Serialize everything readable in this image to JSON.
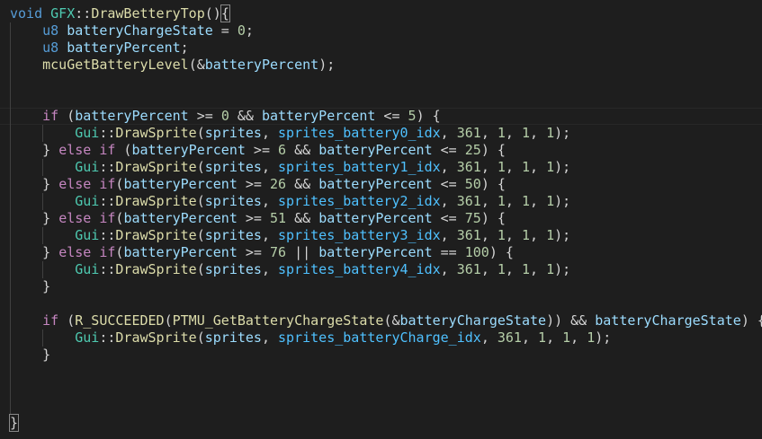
{
  "editor": {
    "current_line": 6,
    "lines": [
      [
        [
          "kw",
          "void "
        ],
        [
          "type",
          "GFX"
        ],
        [
          "p",
          "::"
        ],
        [
          "fn",
          "DrawBetteryTop"
        ],
        [
          "p",
          "()"
        ],
        [
          "match",
          "{"
        ]
      ],
      [
        [
          "p",
          "    "
        ],
        [
          "kw",
          "u8 "
        ],
        [
          "var",
          "batteryChargeState"
        ],
        [
          "p",
          " = "
        ],
        [
          "num",
          "0"
        ],
        [
          "p",
          ";"
        ]
      ],
      [
        [
          "p",
          "    "
        ],
        [
          "kw",
          "u8 "
        ],
        [
          "var",
          "batteryPercent"
        ],
        [
          "p",
          ";"
        ]
      ],
      [
        [
          "p",
          "    "
        ],
        [
          "fn",
          "mcuGetBatteryLevel"
        ],
        [
          "p",
          "(&"
        ],
        [
          "var",
          "batteryPercent"
        ],
        [
          "p",
          ");"
        ]
      ],
      [],
      [],
      [
        [
          "p",
          "    "
        ],
        [
          "ctl",
          "if"
        ],
        [
          "p",
          " ("
        ],
        [
          "var",
          "batteryPercent"
        ],
        [
          "p",
          " >= "
        ],
        [
          "num",
          "0"
        ],
        [
          "p",
          " && "
        ],
        [
          "var",
          "batteryPercent"
        ],
        [
          "p",
          " <= "
        ],
        [
          "num",
          "5"
        ],
        [
          "p",
          ") {"
        ]
      ],
      [
        [
          "p",
          "        "
        ],
        [
          "type",
          "Gui"
        ],
        [
          "p",
          "::"
        ],
        [
          "fn",
          "DrawSprite"
        ],
        [
          "p",
          "("
        ],
        [
          "var",
          "sprites"
        ],
        [
          "p",
          ", "
        ],
        [
          "enum",
          "sprites_battery0_idx"
        ],
        [
          "p",
          ", "
        ],
        [
          "num",
          "361"
        ],
        [
          "p",
          ", "
        ],
        [
          "num",
          "1"
        ],
        [
          "p",
          ", "
        ],
        [
          "num",
          "1"
        ],
        [
          "p",
          ", "
        ],
        [
          "num",
          "1"
        ],
        [
          "p",
          ");"
        ]
      ],
      [
        [
          "p",
          "    } "
        ],
        [
          "ctl",
          "else if"
        ],
        [
          "p",
          " ("
        ],
        [
          "var",
          "batteryPercent"
        ],
        [
          "p",
          " >= "
        ],
        [
          "num",
          "6"
        ],
        [
          "p",
          " && "
        ],
        [
          "var",
          "batteryPercent"
        ],
        [
          "p",
          " <= "
        ],
        [
          "num",
          "25"
        ],
        [
          "p",
          ") {"
        ]
      ],
      [
        [
          "p",
          "        "
        ],
        [
          "type",
          "Gui"
        ],
        [
          "p",
          "::"
        ],
        [
          "fn",
          "DrawSprite"
        ],
        [
          "p",
          "("
        ],
        [
          "var",
          "sprites"
        ],
        [
          "p",
          ", "
        ],
        [
          "enum",
          "sprites_battery1_idx"
        ],
        [
          "p",
          ", "
        ],
        [
          "num",
          "361"
        ],
        [
          "p",
          ", "
        ],
        [
          "num",
          "1"
        ],
        [
          "p",
          ", "
        ],
        [
          "num",
          "1"
        ],
        [
          "p",
          ", "
        ],
        [
          "num",
          "1"
        ],
        [
          "p",
          ");"
        ]
      ],
      [
        [
          "p",
          "    } "
        ],
        [
          "ctl",
          "else if"
        ],
        [
          "p",
          "("
        ],
        [
          "var",
          "batteryPercent"
        ],
        [
          "p",
          " >= "
        ],
        [
          "num",
          "26"
        ],
        [
          "p",
          " && "
        ],
        [
          "var",
          "batteryPercent"
        ],
        [
          "p",
          " <= "
        ],
        [
          "num",
          "50"
        ],
        [
          "p",
          ") {"
        ]
      ],
      [
        [
          "p",
          "        "
        ],
        [
          "type",
          "Gui"
        ],
        [
          "p",
          "::"
        ],
        [
          "fn",
          "DrawSprite"
        ],
        [
          "p",
          "("
        ],
        [
          "var",
          "sprites"
        ],
        [
          "p",
          ", "
        ],
        [
          "enum",
          "sprites_battery2_idx"
        ],
        [
          "p",
          ", "
        ],
        [
          "num",
          "361"
        ],
        [
          "p",
          ", "
        ],
        [
          "num",
          "1"
        ],
        [
          "p",
          ", "
        ],
        [
          "num",
          "1"
        ],
        [
          "p",
          ", "
        ],
        [
          "num",
          "1"
        ],
        [
          "p",
          ");"
        ]
      ],
      [
        [
          "p",
          "    } "
        ],
        [
          "ctl",
          "else if"
        ],
        [
          "p",
          "("
        ],
        [
          "var",
          "batteryPercent"
        ],
        [
          "p",
          " >= "
        ],
        [
          "num",
          "51"
        ],
        [
          "p",
          " && "
        ],
        [
          "var",
          "batteryPercent"
        ],
        [
          "p",
          " <= "
        ],
        [
          "num",
          "75"
        ],
        [
          "p",
          ") {"
        ]
      ],
      [
        [
          "p",
          "        "
        ],
        [
          "type",
          "Gui"
        ],
        [
          "p",
          "::"
        ],
        [
          "fn",
          "DrawSprite"
        ],
        [
          "p",
          "("
        ],
        [
          "var",
          "sprites"
        ],
        [
          "p",
          ", "
        ],
        [
          "enum",
          "sprites_battery3_idx"
        ],
        [
          "p",
          ", "
        ],
        [
          "num",
          "361"
        ],
        [
          "p",
          ", "
        ],
        [
          "num",
          "1"
        ],
        [
          "p",
          ", "
        ],
        [
          "num",
          "1"
        ],
        [
          "p",
          ", "
        ],
        [
          "num",
          "1"
        ],
        [
          "p",
          ");"
        ]
      ],
      [
        [
          "p",
          "    } "
        ],
        [
          "ctl",
          "else if"
        ],
        [
          "p",
          "("
        ],
        [
          "var",
          "batteryPercent"
        ],
        [
          "p",
          " >= "
        ],
        [
          "num",
          "76"
        ],
        [
          "p",
          " || "
        ],
        [
          "var",
          "batteryPercent"
        ],
        [
          "p",
          " == "
        ],
        [
          "num",
          "100"
        ],
        [
          "p",
          ") {"
        ]
      ],
      [
        [
          "p",
          "        "
        ],
        [
          "type",
          "Gui"
        ],
        [
          "p",
          "::"
        ],
        [
          "fn",
          "DrawSprite"
        ],
        [
          "p",
          "("
        ],
        [
          "var",
          "sprites"
        ],
        [
          "p",
          ", "
        ],
        [
          "enum",
          "sprites_battery4_idx"
        ],
        [
          "p",
          ", "
        ],
        [
          "num",
          "361"
        ],
        [
          "p",
          ", "
        ],
        [
          "num",
          "1"
        ],
        [
          "p",
          ", "
        ],
        [
          "num",
          "1"
        ],
        [
          "p",
          ", "
        ],
        [
          "num",
          "1"
        ],
        [
          "p",
          ");"
        ]
      ],
      [
        [
          "p",
          "    }"
        ]
      ],
      [],
      [
        [
          "p",
          "    "
        ],
        [
          "ctl",
          "if"
        ],
        [
          "p",
          " ("
        ],
        [
          "fn",
          "R_SUCCEEDED"
        ],
        [
          "p",
          "("
        ],
        [
          "fn",
          "PTMU_GetBatteryChargeState"
        ],
        [
          "p",
          "(&"
        ],
        [
          "var",
          "batteryChargeState"
        ],
        [
          "p",
          ")) && "
        ],
        [
          "var",
          "batteryChargeState"
        ],
        [
          "p",
          ") {"
        ]
      ],
      [
        [
          "p",
          "        "
        ],
        [
          "type",
          "Gui"
        ],
        [
          "p",
          "::"
        ],
        [
          "fn",
          "DrawSprite"
        ],
        [
          "p",
          "("
        ],
        [
          "var",
          "sprites"
        ],
        [
          "p",
          ", "
        ],
        [
          "enum",
          "sprites_batteryCharge_idx"
        ],
        [
          "p",
          ", "
        ],
        [
          "num",
          "361"
        ],
        [
          "p",
          ", "
        ],
        [
          "num",
          "1"
        ],
        [
          "p",
          ", "
        ],
        [
          "num",
          "1"
        ],
        [
          "p",
          ", "
        ],
        [
          "num",
          "1"
        ],
        [
          "p",
          ");"
        ]
      ],
      [
        [
          "p",
          "    }"
        ]
      ],
      [],
      [],
      [],
      [
        [
          "match",
          "}"
        ]
      ]
    ]
  }
}
